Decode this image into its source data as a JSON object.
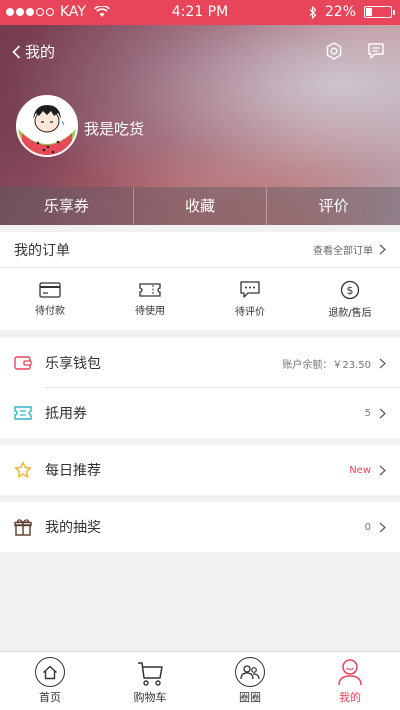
{
  "status_bar": {
    "carrier": "KAY",
    "time": "4:21 PM",
    "battery": "22%"
  },
  "header": {
    "back_label": "我的",
    "username": "我是吃货",
    "tabs": [
      "乐享券",
      "收藏",
      "评价"
    ]
  },
  "orders": {
    "title": "我的订单",
    "view_all": "查看全部订单",
    "items": [
      "待付款",
      "待使用",
      "待评价",
      "退款/售后"
    ]
  },
  "wallet_group": [
    {
      "label": "乐享钱包",
      "value": "账户余额：￥23.50"
    },
    {
      "label": "抵用券",
      "value": "5"
    }
  ],
  "recommend": {
    "label": "每日推荐",
    "value": "New"
  },
  "lottery": {
    "label": "我的抽奖",
    "value": "0"
  },
  "bottom_nav": [
    "首页",
    "购物车",
    "圈圈",
    "我的"
  ],
  "colors": {
    "accent": "#e8445a",
    "coupon_icon": "#2bb6c6",
    "star_icon": "#f0b429",
    "gift_icon": "#5a3a2a"
  }
}
